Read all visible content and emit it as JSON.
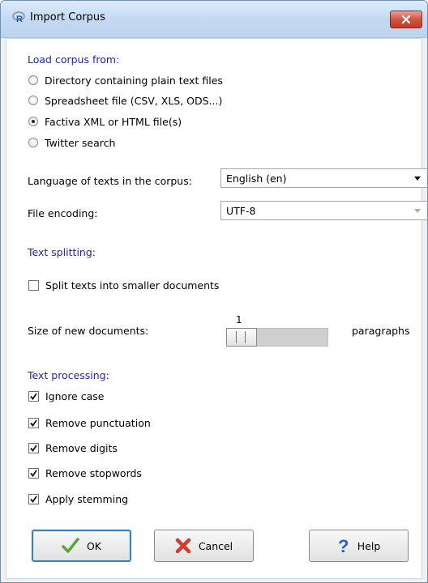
{
  "window": {
    "title": "Import Corpus"
  },
  "load_section": {
    "label": "Load corpus from:",
    "options": [
      {
        "label": "Directory containing plain text files",
        "selected": false
      },
      {
        "label": "Spreadsheet file (CSV, XLS, ODS...)",
        "selected": false
      },
      {
        "label": "Factiva XML or HTML file(s)",
        "selected": true
      },
      {
        "label": "Twitter search",
        "selected": false
      }
    ]
  },
  "language": {
    "label": "Language of texts in the corpus:",
    "value": "English (en)"
  },
  "encoding": {
    "label": "File encoding:",
    "value": "UTF-8"
  },
  "splitting": {
    "label": "Text splitting:",
    "split_label": "Split texts into smaller documents",
    "split_checked": false,
    "size_label": "Size of new documents:",
    "size_value": "1",
    "size_unit": "paragraphs"
  },
  "processing": {
    "label": "Text processing:",
    "options": [
      {
        "label": "Ignore case",
        "checked": true
      },
      {
        "label": "Remove punctuation",
        "checked": true
      },
      {
        "label": "Remove digits",
        "checked": true
      },
      {
        "label": "Remove stopwords",
        "checked": true
      },
      {
        "label": "Apply stemming",
        "checked": true
      }
    ]
  },
  "buttons": {
    "ok": "OK",
    "cancel": "Cancel",
    "help": "Help"
  },
  "colors": {
    "section_label": "#2020d0",
    "ok_check": "#5aa53a",
    "cancel_x": "#d33b2a",
    "help_question": "#2560c8"
  }
}
